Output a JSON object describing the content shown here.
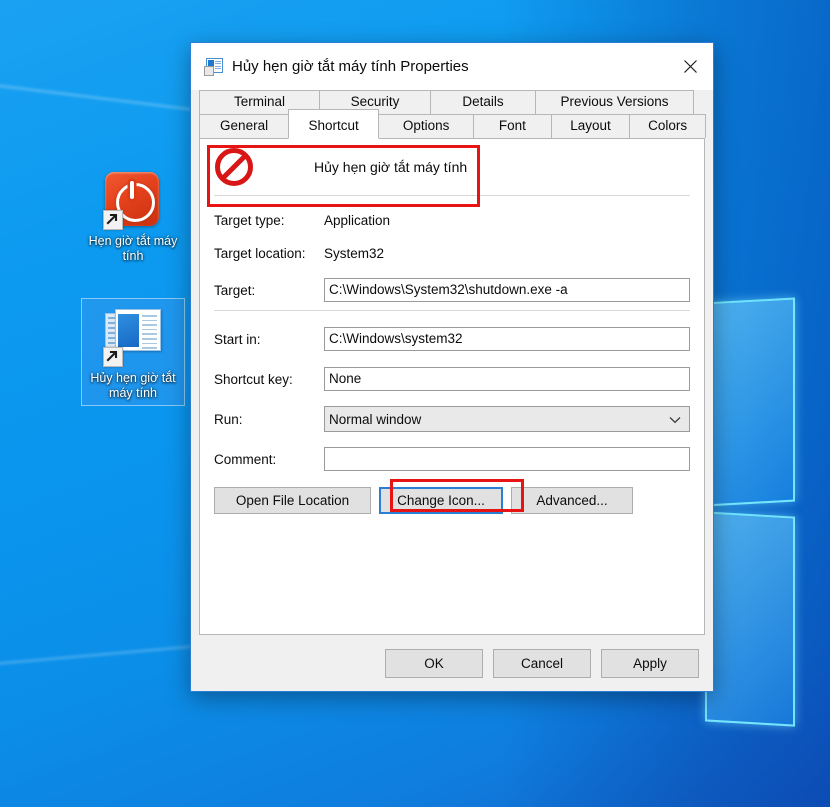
{
  "desktop": {
    "icons": [
      {
        "name": "hen-gio-tat-may-tinh",
        "label": "Hẹn giờ tắt máy tính",
        "icon": "power-button-icon",
        "selected": false
      },
      {
        "name": "huy-hen-gio-tat-may-tinh",
        "label": "Hủy hẹn giờ tắt máy tính",
        "icon": "window-document-icon",
        "selected": true
      }
    ],
    "wallpaper_colors": {
      "light_blue": "#0d9bf0",
      "deep_blue": "#1264c9",
      "logo_glow": "#78ebff"
    }
  },
  "dialog": {
    "title": "Hủy hẹn giờ tắt máy tính Properties",
    "title_icon": "shortcut-window-icon",
    "close_label": "✕",
    "accent_color": "#2a7fd4",
    "annotation_color": "#e81313",
    "tabs_row1": [
      {
        "label": "Terminal",
        "active": false,
        "class": "t-terminal"
      },
      {
        "label": "Security",
        "active": false,
        "class": "t-security"
      },
      {
        "label": "Details",
        "active": false,
        "class": "t-details"
      },
      {
        "label": "Previous Versions",
        "active": false,
        "class": "t-prev"
      }
    ],
    "tabs_row2": [
      {
        "label": "General",
        "active": false,
        "class": "t-general"
      },
      {
        "label": "Shortcut",
        "active": true,
        "class": "t-shortcut"
      },
      {
        "label": "Options",
        "active": false,
        "class": "t-options"
      },
      {
        "label": "Font",
        "active": false,
        "class": "t-font"
      },
      {
        "label": "Layout",
        "active": false,
        "class": "t-layout"
      },
      {
        "label": "Colors",
        "active": false,
        "class": "t-colors"
      }
    ],
    "shortcut_tab": {
      "header_name": "Hủy hẹn giờ tắt máy tính",
      "header_icon": "no-entry-icon",
      "fields": [
        {
          "label": "Target type:",
          "value": "Application",
          "kind": "static"
        },
        {
          "label": "Target location:",
          "value": "System32",
          "kind": "static"
        },
        {
          "label": "Target:",
          "value": "C:\\Windows\\System32\\shutdown.exe -a",
          "kind": "input"
        },
        {
          "label": "Start in:",
          "value": "C:\\Windows\\system32",
          "kind": "input"
        },
        {
          "label": "Shortcut key:",
          "value": "None",
          "kind": "input"
        },
        {
          "label": "Run:",
          "value": "Normal window",
          "kind": "combo"
        },
        {
          "label": "Comment:",
          "value": "",
          "kind": "input"
        }
      ],
      "buttons": {
        "open_file_location": "Open File Location",
        "change_icon": "Change Icon...",
        "advanced": "Advanced..."
      }
    },
    "footer_buttons": {
      "ok": "OK",
      "cancel": "Cancel",
      "apply": "Apply"
    }
  }
}
